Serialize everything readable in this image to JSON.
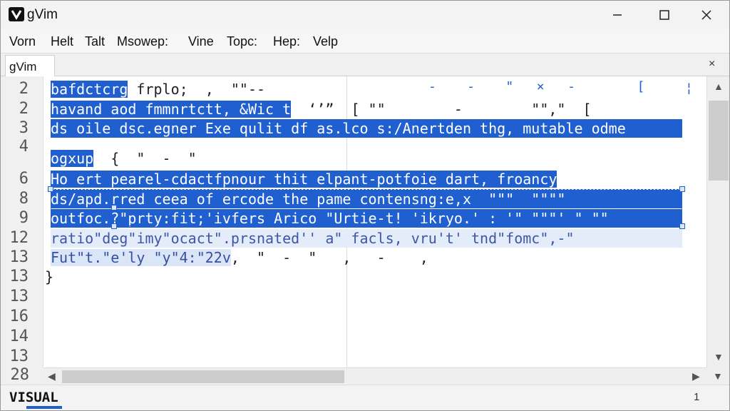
{
  "window": {
    "title": "gVim",
    "icon": "vim-logo-icon"
  },
  "menu": [
    {
      "label": "Vorn"
    },
    {
      "label": "Helt"
    },
    {
      "label": "Talt"
    },
    {
      "label": "Msowep:"
    },
    {
      "label": "Vine"
    },
    {
      "label": "Topc:"
    },
    {
      "label": "Hep:"
    },
    {
      "label": "Velp"
    }
  ],
  "tab": {
    "label": "gVim",
    "close": "×"
  },
  "gutter": {
    "numbers": [
      "2",
      "2",
      "3",
      "4",
      "6",
      "8",
      "9",
      "12",
      "13",
      "13",
      "13",
      "16",
      "14",
      "13"
    ],
    "bottom_number": "28"
  },
  "code": {
    "lines": [
      {
        "text": "bafdctcrg",
        "rest": " frplo;  ,  \"\"--"
      },
      {
        "text": "havand aod fmmnrtctt, &Wic t",
        "rest": "  ‘’”  [ \"\"        -        \"\",\"  ["
      },
      {
        "text": "ds oile dsc.egner Exe qulit df as.lco s:/Anertden thg, mutable odme",
        "rest": ""
      },
      {
        "text": "ogxup",
        "rest": "  {  \"  -  \""
      },
      {
        "text": "Ho ert pearel-cdactfpnour thit elpant-potfoie dart, froancy",
        "rest": ""
      },
      {
        "text": "ds/apd.rred ceea of ercode the pame contensng:e,x  \"\"\"  \"\"\"\"",
        "rest": ""
      },
      {
        "text": "outfoc.?\"prty:fit;'ivfers Arico \"Urtie-t! 'ikryo.' : '\" \"\"\"' \" \"\"",
        "rest": ""
      },
      {
        "text": "ratio\"deg\"imy\"ocact\".prsnated'' a\" facls, vru't' tnd\"fomc\",-\"",
        "rest": ""
      },
      {
        "text": "Fut\"t.\"e'ly \"y\"4:\"22v",
        "rest": ",  \"  -  \"   ,   -    ,"
      },
      {
        "text": "}",
        "rest": ""
      }
    ],
    "top_right_glyphs": "-    -    \"   ×   -        [",
    "right_glyph": "¦"
  },
  "statusbar": {
    "mode": "VISUAL",
    "position": "1"
  },
  "colors": {
    "selection": "#1f5fd0",
    "selection_light": "#9fb9ec",
    "gutter_bg": "#f0f0f0"
  }
}
